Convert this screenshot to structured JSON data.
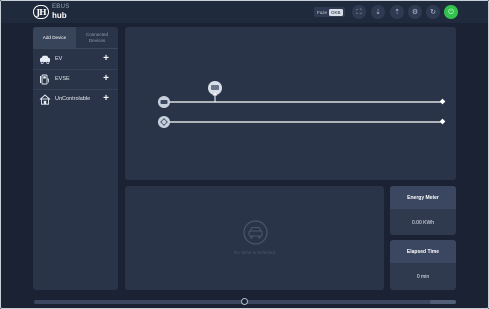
{
  "app": {
    "logo_badge": "JH",
    "logo_line1": "EBUS",
    "logo_line2": "hub"
  },
  "header": {
    "toggle_label": "Fuze",
    "toggle_value": "OKB",
    "buttons": [
      {
        "name": "fullscreen",
        "glyph": "⛶"
      },
      {
        "name": "sort-down",
        "glyph": "⇣"
      },
      {
        "name": "sort-up",
        "glyph": "⇡"
      },
      {
        "name": "settings",
        "glyph": "⚙"
      },
      {
        "name": "refresh",
        "glyph": "↻"
      },
      {
        "name": "power",
        "glyph": "⏻"
      }
    ],
    "power_color": "#33c24d"
  },
  "left_panel": {
    "tabs": [
      {
        "label": "Add Device",
        "active": true
      },
      {
        "label": "Connected Devices",
        "active": false
      }
    ],
    "devices": [
      {
        "label": "EV",
        "icon": "car-icon",
        "add": "+"
      },
      {
        "label": "EVSE",
        "icon": "charger-icon",
        "add": "+"
      },
      {
        "label": "UnControlable",
        "icon": "house-icon",
        "add": "+"
      }
    ]
  },
  "canvas": {
    "nodes": [
      {
        "name": "hub-node",
        "icon": "hub-icon"
      },
      {
        "name": "meter-node",
        "icon": "meter-icon"
      },
      {
        "name": "sun-node",
        "icon": "sun-icon"
      }
    ]
  },
  "status": {
    "text": "No Sims is Selected",
    "icon": "car-placeholder-icon"
  },
  "metrics": {
    "energy_title": "Energy Meter",
    "energy_value": "0.00 KWh",
    "time_title": "Elapsed Time",
    "time_value": "0 min"
  },
  "colors": {
    "background": "#1a2234",
    "panel": "#2a3448",
    "accent_green": "#33c24d"
  }
}
